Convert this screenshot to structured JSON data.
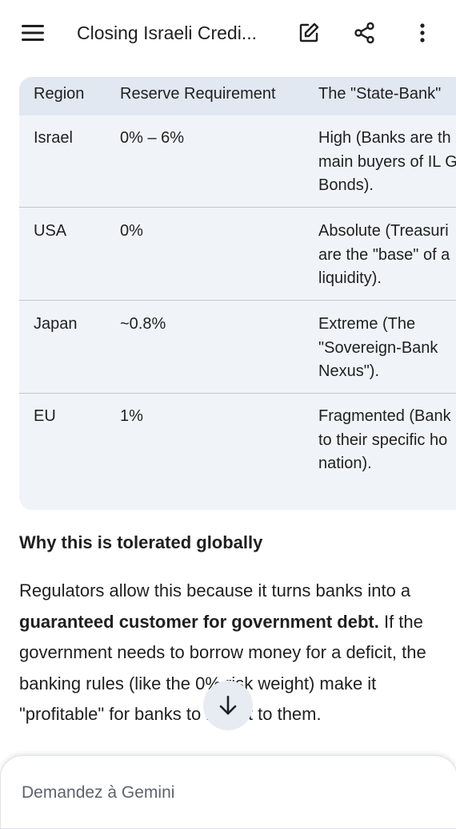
{
  "header": {
    "title": "Closing Israeli Credi...",
    "menu_icon": "menu-icon",
    "edit_icon": "edit-icon",
    "share_icon": "share-icon",
    "more_icon": "more-vert-icon"
  },
  "table": {
    "columns": [
      "Region",
      "Reserve Requirement",
      "The \"State-Bank\""
    ],
    "rows": [
      {
        "region": "Israel",
        "reserve": "0% – 6%",
        "state_bank": [
          "High (Banks are th",
          "main buyers of IL G",
          "Bonds)."
        ]
      },
      {
        "region": "USA",
        "reserve": "0%",
        "state_bank": [
          "Absolute (Treasuri",
          "are the \"base\" of a",
          "liquidity)."
        ]
      },
      {
        "region": "Japan",
        "reserve": "~0.8%",
        "state_bank": [
          "Extreme (The",
          "\"Sovereign-Bank",
          "Nexus\")."
        ]
      },
      {
        "region": "EU",
        "reserve": "1%",
        "state_bank": [
          "Fragmented (Bank",
          "to their specific ho",
          "nation)."
        ]
      }
    ]
  },
  "section": {
    "heading": "Why this is tolerated globally",
    "para_part1": "Regulators allow this because it turns banks into a ",
    "para_bold": "guaranteed customer for government debt.",
    "para_part2": " If the government needs to borrow money for a deficit, the banking rules (like the 0% risk weight) make it \"profitable\" for banks to lend it to them."
  },
  "scroll_button_icon": "arrow-down-icon",
  "input": {
    "placeholder": "Demandez à Gemini"
  },
  "colors": {
    "table_bg": "#f0f4f9",
    "table_header_bg": "#e1e8f1",
    "text": "#1f1f1f"
  }
}
